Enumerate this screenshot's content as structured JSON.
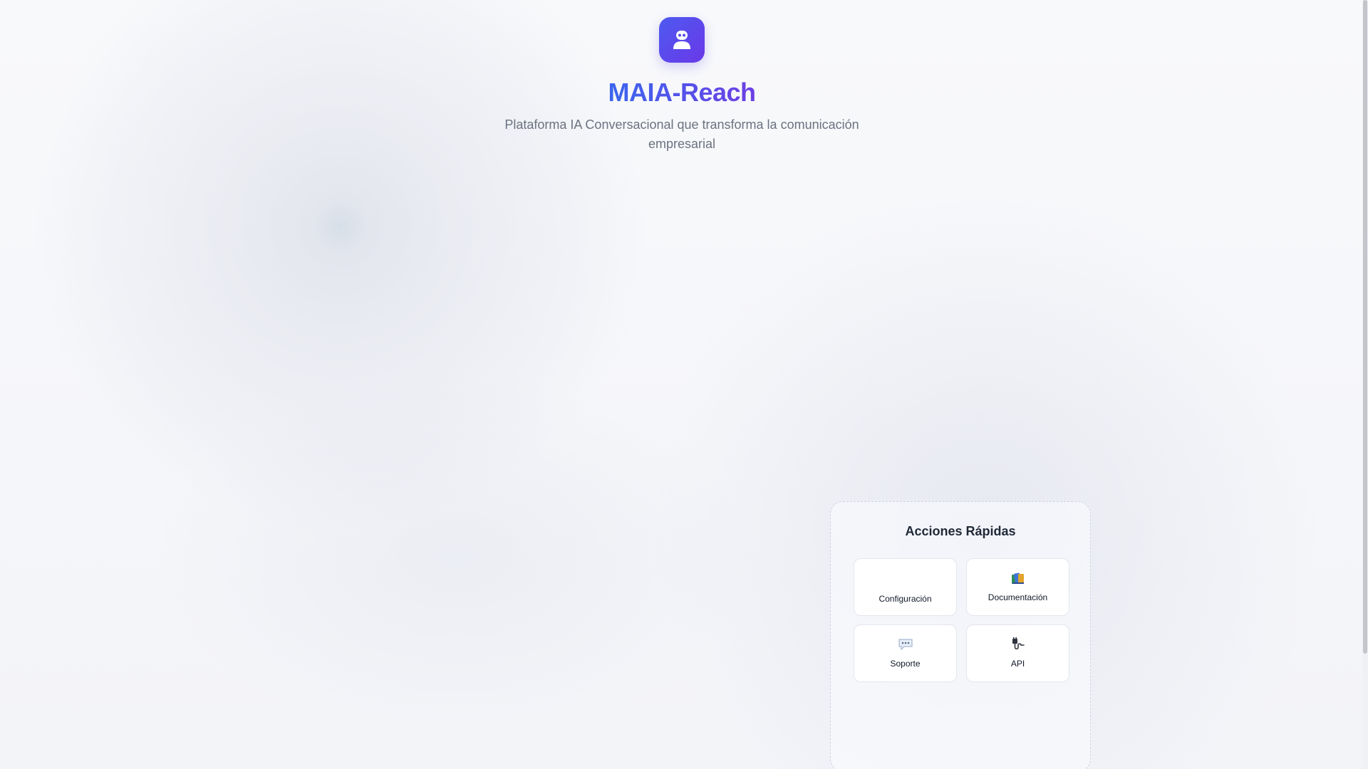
{
  "brand": {
    "logo_icon": "robot-icon",
    "title": "MAIA-Reach",
    "subtitle": "Plataforma IA Conversacional que transforma la comunicación empresarial",
    "accent_colors": [
      "#3b66ee",
      "#6d3fe4"
    ]
  },
  "quick_actions": {
    "title": "Acciones Rápidas",
    "items": [
      {
        "label": "Configuración",
        "icon": "settings-icon"
      },
      {
        "label": "Documentación",
        "icon": "books-icon"
      },
      {
        "label": "Soporte",
        "icon": "speech-bubble-icon"
      },
      {
        "label": "API",
        "icon": "plug-icon"
      }
    ]
  }
}
